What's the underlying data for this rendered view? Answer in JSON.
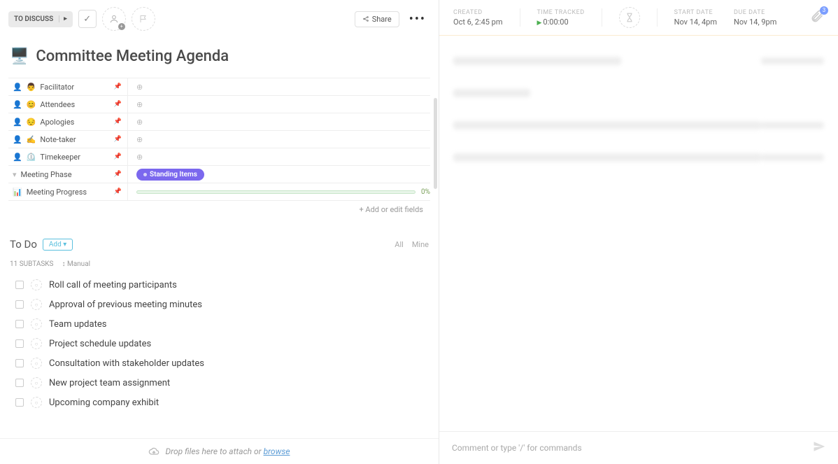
{
  "toolbar": {
    "status_label": "TO DISCUSS",
    "share_label": "Share",
    "check_glyph": "✓"
  },
  "title": {
    "icon": "🖥️",
    "text": "Committee Meeting Agenda"
  },
  "fields": [
    {
      "icon": "👨",
      "label": "Facilitator",
      "value": ""
    },
    {
      "icon": "😊",
      "label": "Attendees",
      "value": ""
    },
    {
      "icon": "😔",
      "label": "Apologies",
      "value": ""
    },
    {
      "icon": "✍️",
      "label": "Note-taker",
      "value": ""
    },
    {
      "icon": "⏲️",
      "label": "Timekeeper",
      "value": ""
    }
  ],
  "phase_field": {
    "label": "Meeting Phase",
    "tag": "Standing Items"
  },
  "progress_field": {
    "label": "Meeting Progress",
    "pct": "0%"
  },
  "add_fields_label": "+ Add or edit fields",
  "todo": {
    "title": "To Do",
    "add": "Add",
    "all": "All",
    "mine": "Mine",
    "count_label": "11 SUBTASKS",
    "sort_label": "Manual"
  },
  "subtasks": [
    "Roll call of meeting participants",
    "Approval of previous meeting minutes",
    "Team updates",
    "Project schedule updates",
    "Consultation with stakeholder updates",
    "New project team assignment",
    "Upcoming company exhibit"
  ],
  "drop": {
    "text": "Drop files here to attach or ",
    "link": "browse"
  },
  "meta": {
    "created": {
      "label": "CREATED",
      "value": "Oct 6, 2:45 pm"
    },
    "time_tracked": {
      "label": "TIME TRACKED",
      "value": "0:00:00"
    },
    "start_date": {
      "label": "START DATE",
      "value": "Nov 14, 4pm"
    },
    "due_date": {
      "label": "DUE DATE",
      "value": "Nov 14, 9pm"
    },
    "attach_count": "3"
  },
  "comment_placeholder": "Comment or type '/' for commands"
}
